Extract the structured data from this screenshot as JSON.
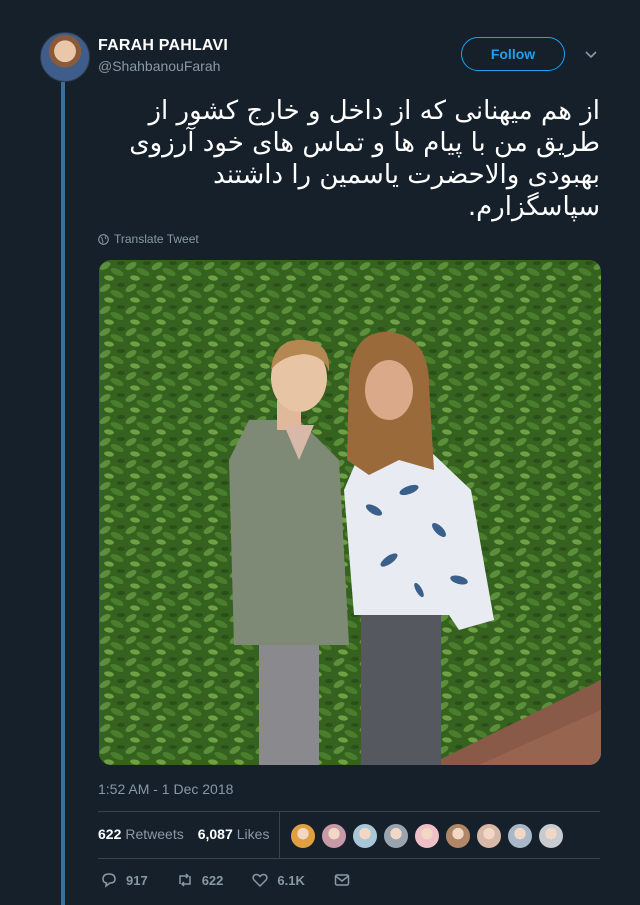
{
  "author": {
    "name": "FARAH PAHLAVI",
    "handle": "@ShahbanouFarah"
  },
  "follow_label": "Follow",
  "tweet": {
    "lines": [
      "از هم میهنانی که از داخل و خارج کشور از",
      "طریق من با پیام ها و تماس های خود آرزوی",
      "بهبودی والاحضرت یاسمین را داشتند",
      "سپاسگزارم."
    ],
    "translate_label": "Translate Tweet",
    "timestamp": "1:52 AM - 1 Dec 2018"
  },
  "stats": {
    "retweets_count": "622",
    "retweets_label": "Retweets",
    "likes_count": "6,087",
    "likes_label": "Likes"
  },
  "likers": [
    "#e0a040",
    "#c89aa8",
    "#a8c8d8",
    "#9aa4ae",
    "#f0c0c8",
    "#b08868",
    "#d8b8a8",
    "#a8b8c8",
    "#c8ccd0"
  ],
  "actions": {
    "replies": "917",
    "retweets": "622",
    "likes": "6.1K"
  },
  "colors": {
    "background": "#15202b",
    "accent": "#1da1f2",
    "muted": "#8899a6",
    "thread_line": "#3a6f99"
  }
}
